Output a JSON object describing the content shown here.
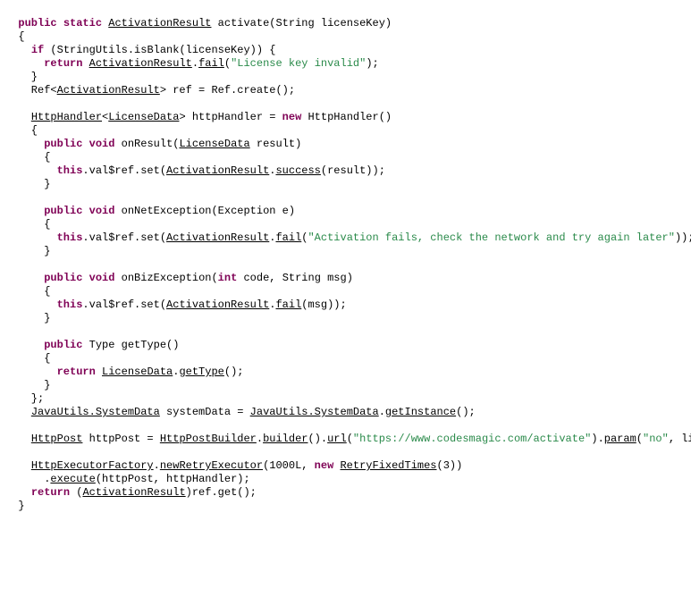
{
  "code": {
    "tokens": [
      [
        [
          "pad",
          1
        ],
        [
          "kw",
          "public"
        ],
        [
          "t",
          " "
        ],
        [
          "kw",
          "static"
        ],
        [
          "t",
          " "
        ],
        [
          "u",
          "ActivationResult"
        ],
        [
          "t",
          " activate(String licenseKey)"
        ]
      ],
      [
        [
          "pad",
          1
        ],
        [
          "t",
          "{"
        ]
      ],
      [
        [
          "pad",
          2
        ],
        [
          "kw",
          "if"
        ],
        [
          "t",
          " (StringUtils.isBlank(licenseKey)) {"
        ]
      ],
      [
        [
          "pad",
          3
        ],
        [
          "kw",
          "return"
        ],
        [
          "t",
          " "
        ],
        [
          "u",
          "ActivationResult"
        ],
        [
          "t",
          "."
        ],
        [
          "u",
          "fail"
        ],
        [
          "t",
          "("
        ],
        [
          "str",
          "\"License key invalid\""
        ],
        [
          "t",
          ");"
        ]
      ],
      [
        [
          "pad",
          2
        ],
        [
          "t",
          "}"
        ]
      ],
      [
        [
          "pad",
          2
        ],
        [
          "t",
          "Ref<"
        ],
        [
          "u",
          "ActivationResult"
        ],
        [
          "t",
          "> ref = Ref.create();"
        ]
      ],
      [
        [
          "pad",
          2
        ]
      ],
      [
        [
          "pad",
          2
        ],
        [
          "u",
          "HttpHandler"
        ],
        [
          "t",
          "<"
        ],
        [
          "u",
          "LicenseData"
        ],
        [
          "t",
          "> httpHandler = "
        ],
        [
          "kw",
          "new"
        ],
        [
          "t",
          " HttpHandler()"
        ]
      ],
      [
        [
          "pad",
          2
        ],
        [
          "t",
          "{"
        ]
      ],
      [
        [
          "pad",
          3
        ],
        [
          "kw",
          "public"
        ],
        [
          "t",
          " "
        ],
        [
          "kw",
          "void"
        ],
        [
          "t",
          " onResult("
        ],
        [
          "u",
          "LicenseData"
        ],
        [
          "t",
          " result)"
        ]
      ],
      [
        [
          "pad",
          3
        ],
        [
          "t",
          "{"
        ]
      ],
      [
        [
          "pad",
          4
        ],
        [
          "kw",
          "this"
        ],
        [
          "t",
          ".val$ref.set("
        ],
        [
          "u",
          "ActivationResult"
        ],
        [
          "t",
          "."
        ],
        [
          "u",
          "success"
        ],
        [
          "t",
          "(result));"
        ]
      ],
      [
        [
          "pad",
          3
        ],
        [
          "t",
          "}"
        ]
      ],
      [
        [
          "pad",
          3
        ]
      ],
      [
        [
          "pad",
          3
        ],
        [
          "kw",
          "public"
        ],
        [
          "t",
          " "
        ],
        [
          "kw",
          "void"
        ],
        [
          "t",
          " onNetException(Exception e)"
        ]
      ],
      [
        [
          "pad",
          3
        ],
        [
          "t",
          "{"
        ]
      ],
      [
        [
          "pad",
          4
        ],
        [
          "kw",
          "this"
        ],
        [
          "t",
          ".val$ref.set("
        ],
        [
          "u",
          "ActivationResult"
        ],
        [
          "t",
          "."
        ],
        [
          "u",
          "fail"
        ],
        [
          "t",
          "("
        ],
        [
          "str",
          "\"Activation fails, check the network and try again later\""
        ],
        [
          "t",
          "));"
        ]
      ],
      [
        [
          "pad",
          3
        ],
        [
          "t",
          "}"
        ]
      ],
      [
        [
          "pad",
          3
        ]
      ],
      [
        [
          "pad",
          3
        ],
        [
          "kw",
          "public"
        ],
        [
          "t",
          " "
        ],
        [
          "kw",
          "void"
        ],
        [
          "t",
          " onBizException("
        ],
        [
          "kw",
          "int"
        ],
        [
          "t",
          " code, String msg)"
        ]
      ],
      [
        [
          "pad",
          3
        ],
        [
          "t",
          "{"
        ]
      ],
      [
        [
          "pad",
          4
        ],
        [
          "kw",
          "this"
        ],
        [
          "t",
          ".val$ref.set("
        ],
        [
          "u",
          "ActivationResult"
        ],
        [
          "t",
          "."
        ],
        [
          "u",
          "fail"
        ],
        [
          "t",
          "(msg));"
        ]
      ],
      [
        [
          "pad",
          3
        ],
        [
          "t",
          "}"
        ]
      ],
      [
        [
          "pad",
          3
        ]
      ],
      [
        [
          "pad",
          3
        ],
        [
          "kw",
          "public"
        ],
        [
          "t",
          " Type getType()"
        ]
      ],
      [
        [
          "pad",
          3
        ],
        [
          "t",
          "{"
        ]
      ],
      [
        [
          "pad",
          4
        ],
        [
          "kw",
          "return"
        ],
        [
          "t",
          " "
        ],
        [
          "u",
          "LicenseData"
        ],
        [
          "t",
          "."
        ],
        [
          "u",
          "getType"
        ],
        [
          "t",
          "();"
        ]
      ],
      [
        [
          "pad",
          3
        ],
        [
          "t",
          "}"
        ]
      ],
      [
        [
          "pad",
          2
        ],
        [
          "t",
          "};"
        ]
      ],
      [
        [
          "pad",
          2
        ],
        [
          "u",
          "JavaUtils.SystemData"
        ],
        [
          "t",
          " systemData = "
        ],
        [
          "u",
          "JavaUtils.SystemData"
        ],
        [
          "t",
          "."
        ],
        [
          "u",
          "getInstance"
        ],
        [
          "t",
          "();"
        ]
      ],
      [
        [
          "pad",
          2
        ]
      ],
      [
        [
          "pad",
          2
        ],
        [
          "u",
          "HttpPost"
        ],
        [
          "t",
          " httpPost = "
        ],
        [
          "u",
          "HttpPostBuilder"
        ],
        [
          "t",
          "."
        ],
        [
          "u",
          "builder"
        ],
        [
          "t",
          "()."
        ],
        [
          "u",
          "url"
        ],
        [
          "t",
          "("
        ],
        [
          "str",
          "\"https://www.codesmagic.com/activate\""
        ],
        [
          "t",
          ")."
        ],
        [
          "u",
          "param"
        ],
        [
          "t",
          "("
        ],
        [
          "str",
          "\"no\""
        ],
        [
          "t",
          ", licens"
        ]
      ],
      [
        [
          "pad",
          2
        ]
      ],
      [
        [
          "pad",
          2
        ],
        [
          "u",
          "HttpExecutorFactory"
        ],
        [
          "t",
          "."
        ],
        [
          "u",
          "newRetryExecutor"
        ],
        [
          "t",
          "(1000L, "
        ],
        [
          "kw",
          "new"
        ],
        [
          "t",
          " "
        ],
        [
          "u",
          "RetryFixedTimes"
        ],
        [
          "t",
          "(3))"
        ]
      ],
      [
        [
          "pad",
          3
        ],
        [
          "t",
          "."
        ],
        [
          "u",
          "execute"
        ],
        [
          "t",
          "(httpPost, httpHandler);"
        ]
      ],
      [
        [
          "pad",
          2
        ],
        [
          "kw",
          "return"
        ],
        [
          "t",
          " ("
        ],
        [
          "u",
          "ActivationResult"
        ],
        [
          "t",
          ")ref.get();"
        ]
      ],
      [
        [
          "pad",
          1
        ],
        [
          "t",
          "}"
        ]
      ]
    ],
    "indent_unit": "  "
  }
}
